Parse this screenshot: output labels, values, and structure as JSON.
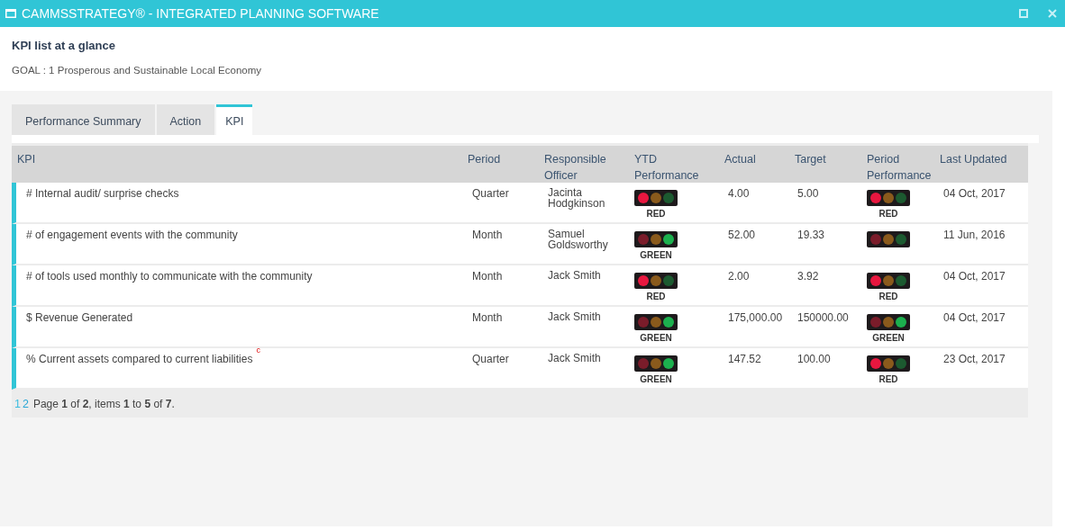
{
  "window": {
    "title": "CAMMSSTRATEGY® - INTEGRATED PLANNING SOFTWARE"
  },
  "page": {
    "title": "KPI list at a glance",
    "goal": "GOAL : 1 Prosperous and Sustainable Local Economy"
  },
  "tabs": [
    {
      "label": "Performance Summary",
      "selected": false
    },
    {
      "label": "Action",
      "selected": false
    },
    {
      "label": "KPI",
      "selected": true
    }
  ],
  "table": {
    "columns": [
      "KPI",
      "Period",
      "Responsible Officer",
      "YTD Performance",
      "Actual",
      "Target",
      "Period Performance",
      "Last Updated"
    ],
    "rows": [
      {
        "kpi": "# Internal audit/ surprise checks",
        "period": "Quarter",
        "officer": "Jacinta Hodgkinson",
        "ytd": {
          "red_on": true,
          "green_on": false,
          "label": "RED"
        },
        "actual": "4.00",
        "target": "5.00",
        "period_performance": {
          "red_on": true,
          "green_on": false,
          "label": "RED"
        },
        "last_updated": "04 Oct, 2017"
      },
      {
        "kpi": "# of engagement events with the community",
        "period": "Month",
        "officer": "Samuel Goldsworthy",
        "ytd": {
          "red_on": false,
          "green_on": true,
          "label": "GREEN"
        },
        "actual": "52.00",
        "target": "19.33",
        "period_performance": {
          "red_on": false,
          "green_on": false
        },
        "last_updated": "11 Jun, 2016"
      },
      {
        "kpi": "# of tools used monthly to communicate with the community",
        "period": "Month",
        "officer": "Jack Smith",
        "ytd": {
          "red_on": true,
          "green_on": false,
          "label": "RED"
        },
        "actual": "2.00",
        "target": "3.92",
        "period_performance": {
          "red_on": true,
          "green_on": false,
          "label": "RED"
        },
        "last_updated": "04 Oct, 2017"
      },
      {
        "kpi": "$ Revenue Generated",
        "period": "Month",
        "officer": "Jack Smith",
        "ytd": {
          "red_on": false,
          "green_on": true,
          "label": "GREEN"
        },
        "actual": "175,000.00",
        "target": "150000.00",
        "period_performance": {
          "red_on": false,
          "green_on": true,
          "label": "GREEN"
        },
        "last_updated": "04 Oct, 2017"
      },
      {
        "kpi": "% Current assets compared to current liabilities",
        "kpi_mark": "c",
        "period": "Quarter",
        "officer": "Jack Smith",
        "ytd": {
          "red_on": false,
          "green_on": true,
          "label": "GREEN"
        },
        "actual": "147.52",
        "target": "100.00",
        "period_performance": {
          "red_on": true,
          "green_on": false,
          "label": "RED"
        },
        "last_updated": "23 Oct, 2017"
      }
    ]
  },
  "pager": {
    "pages": [
      {
        "label": "1",
        "selected": true
      },
      {
        "label": "2",
        "selected": false
      }
    ],
    "info": "Page **1** of **2**, items **1** to **5** of **7**."
  }
}
